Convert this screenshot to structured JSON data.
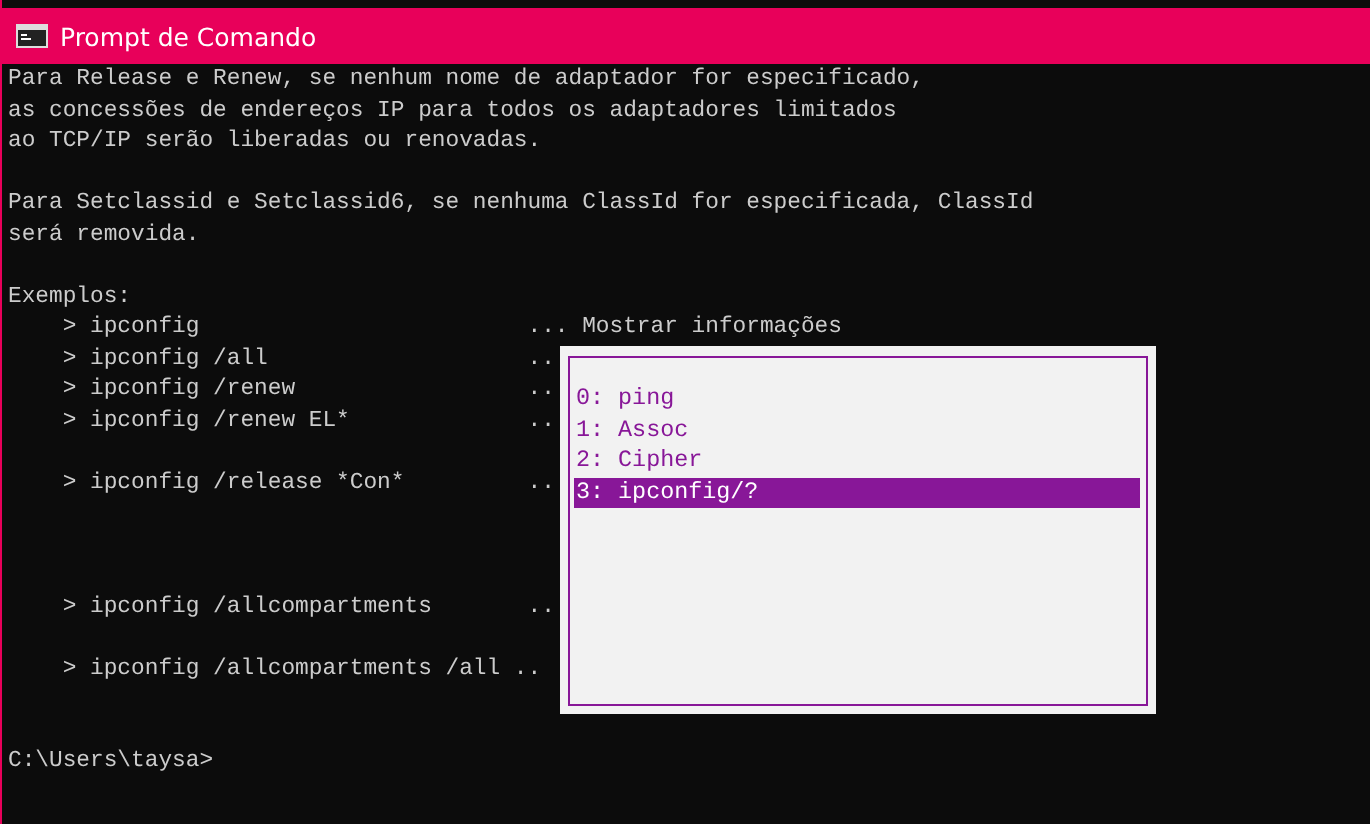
{
  "window": {
    "title": "Prompt de Comando"
  },
  "console_blocks": [
    {
      "lines": [
        "Para Release e Renew, se nenhum nome de adaptador for especificado,",
        "as concessões de endereços IP para todos os adaptadores limitados",
        "ao TCP/IP serão liberadas ou renovadas."
      ]
    },
    {
      "lines": [
        "Para Setclassid e Setclassid6, se nenhuma ClassId for especificada, ClassId",
        "será removida."
      ]
    },
    {
      "lines": [
        "Exemplos:",
        "    > ipconfig                        ... Mostrar informações",
        "    > ipconfig /all                   ..",
        "    > ipconfig /renew                 ..",
        "    > ipconfig /renew EL*             .."
      ]
    },
    {
      "lines": [
        "    > ipconfig /release *Con*         .."
      ]
    },
    {
      "lines": [
        "    > ipconfig /allcompartments       .."
      ]
    },
    {
      "lines": [
        "    > ipconfig /allcompartments /all .."
      ]
    },
    {
      "lines": [
        "C:\\Users\\taysa>"
      ]
    }
  ],
  "history_popup": {
    "items": [
      {
        "label": "0: ping",
        "selected": false
      },
      {
        "label": "1: Assoc",
        "selected": false
      },
      {
        "label": "2: Cipher",
        "selected": false
      },
      {
        "label": "3: ipconfig/?",
        "selected": true
      }
    ]
  }
}
